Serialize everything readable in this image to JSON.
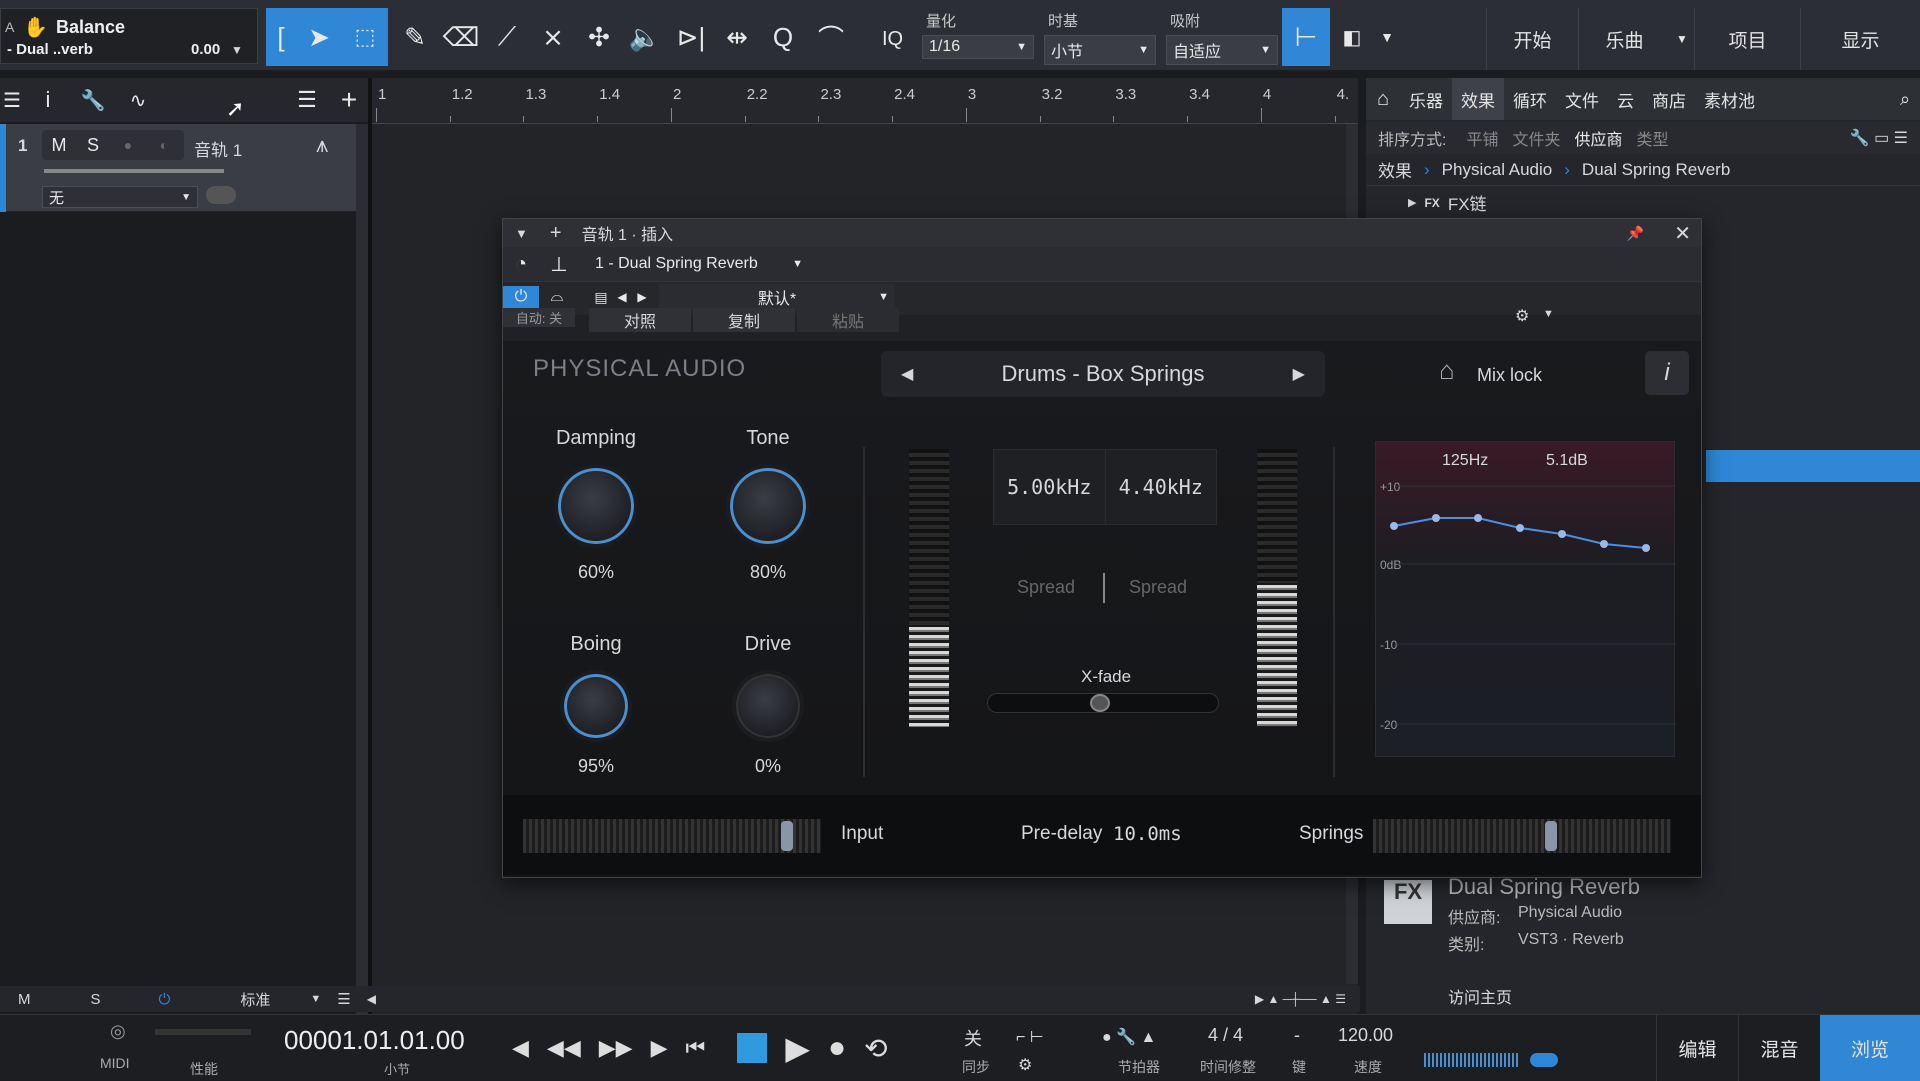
{
  "toolbar": {
    "track_name": "Balance",
    "track_sub": "- Dual ..verb",
    "track_val": "0.00",
    "quantize_label": "量化",
    "quantize_val": "1/16",
    "timebase_label": "时基",
    "timebase_val": "小节",
    "snap_label": "吸附",
    "snap_val": "自适应",
    "iq": "IQ",
    "nav": [
      "开始",
      "乐曲",
      "项目",
      "显示"
    ]
  },
  "ruler": {
    "ticks": [
      "1",
      "1.2",
      "1.3",
      "1.4",
      "2",
      "2.2",
      "2.3",
      "2.4",
      "3",
      "3.2",
      "3.3",
      "3.4",
      "4",
      "4."
    ]
  },
  "track": {
    "number": "1",
    "m": "M",
    "s": "S",
    "name": "音轨 1",
    "input": "无"
  },
  "browser": {
    "tabs": [
      "乐器",
      "效果",
      "循环",
      "文件",
      "云",
      "商店",
      "素材池"
    ],
    "sort_label": "排序方式:",
    "sort_opts": [
      "平铺",
      "文件夹",
      "供应商",
      "类型"
    ],
    "crumbs": [
      "效果",
      "Physical Audio",
      "Dual Spring Reverb"
    ],
    "tree_item": "FX链",
    "info": {
      "title": "Dual Spring Reverb",
      "vendor_k": "供应商:",
      "vendor_v": "Physical Audio",
      "cat_k": "类别:",
      "cat_v": "VST3 · Reverb",
      "home": "访问主页",
      "fx": "FX"
    }
  },
  "plugin": {
    "title": "音轨 1 · 插入",
    "slot": "1 - Dual Spring Reverb",
    "preset": "默认*",
    "auto": "自动: 关",
    "compare": "对照",
    "copy": "复制",
    "paste": "粘贴",
    "brand": "PHYSICAL AUDIO",
    "preset_name": "Drums - Box Springs",
    "mixlock": "Mix lock",
    "info": "i",
    "knobs": [
      {
        "t": "Damping",
        "v": "60%"
      },
      {
        "t": "Tone",
        "v": "80%"
      },
      {
        "t": "Boing",
        "v": "95%"
      },
      {
        "t": "Drive",
        "v": "0%"
      }
    ],
    "freq1": "5.00kHz",
    "freq2": "4.40kHz",
    "spread1": "Spread",
    "spread2": "Spread",
    "xfade": "X-fade",
    "eq_freq": "125Hz",
    "eq_gain": "5.1dB",
    "eq_ticks": [
      "+10",
      "0dB",
      "-10",
      "-20"
    ],
    "input": "Input",
    "predelay_k": "Pre-delay",
    "predelay_v": "10.0ms",
    "springs": "Springs"
  },
  "bottombar": {
    "m": "M",
    "s": "S",
    "std": "标准"
  },
  "transport": {
    "midi": "MIDI",
    "perf": "性能",
    "time": "00001.01.01.00",
    "bar": "小节",
    "sync_v": "关",
    "sync": "同步",
    "metro": "节拍器",
    "sig": "4 / 4",
    "sig_l": "时间修整",
    "key_v": "-",
    "key": "键",
    "tempo": "120.00",
    "tempo_l": "速度",
    "views": [
      "编辑",
      "混音",
      "浏览"
    ]
  },
  "colors": {
    "accent": "#2f87d6"
  }
}
